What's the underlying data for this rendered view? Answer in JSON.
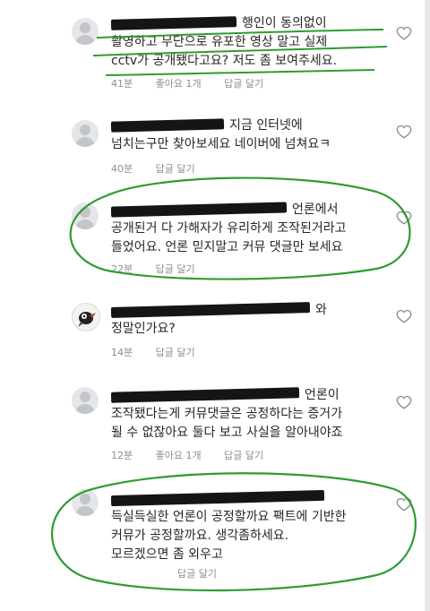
{
  "comments": [
    {
      "lines": [
        "행인이 동의없이",
        "촬영하고 무단으로 유포한 영상 말고 실제",
        "cctv가 공개됐다고요? 저도 좀 보여주세요."
      ],
      "time": "41분",
      "likes": "좋아요 1개",
      "reply": "답글 달기"
    },
    {
      "lines": [
        "지금 인터넷에",
        "넘치는구만 찾아보세요 네이버에 넘쳐요ㅋ"
      ],
      "time": "40분",
      "reply": "답글 달기"
    },
    {
      "lines": [
        "언론에서",
        "공개된거 다 가해자가 유리하게 조작된거라고",
        "들었어요. 언론 믿지말고 커뮤 댓글만 보세요"
      ],
      "time": "22분",
      "reply": "답글 달기"
    },
    {
      "lines": [
        "와",
        "정말인가요?"
      ],
      "time": "14분",
      "reply": "답글 달기"
    },
    {
      "lines": [
        "언론이",
        "조작됐다는게 커뮤댓글은 공정하다는 증거가",
        "될 수 없잖아요 둘다 보고 사실을 알아내야죠"
      ],
      "time": "12분",
      "likes": "좋아요 1개",
      "reply": "답글 달기"
    },
    {
      "lines": [
        "",
        "득실득실한 언론이 공정할까요 팩트에 기반한",
        "커뮤가 공정할까요. 생각좀하세요.",
        "모르겠으면 좀 외우고"
      ],
      "time": "",
      "reply": "답글 달기"
    }
  ],
  "colors": {
    "annotation_green": "#2f9b2f",
    "meta_gray": "#8e8e8e",
    "text": "#262626",
    "redaction": "#151515"
  },
  "icons": [
    "default-avatar-icon",
    "bird-avatar-icon",
    "heart-outline-icon"
  ]
}
